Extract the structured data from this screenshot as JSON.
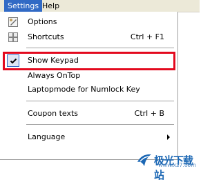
{
  "menubar": {
    "items": [
      {
        "label": "Settings",
        "active": true
      },
      {
        "label": "Help",
        "active": false
      }
    ]
  },
  "menu": {
    "options": {
      "label": "Options",
      "icon": "options-icon"
    },
    "shortcuts": {
      "label": "Shortcuts",
      "shortcut": "Ctrl + F1",
      "icon": "shortcuts-icon"
    },
    "show_keypad": {
      "label": "Show Keypad",
      "checked": true
    },
    "always_ontop": {
      "label": "Always OnTop"
    },
    "laptopmode": {
      "label": "Laptopmode for Numlock Key"
    },
    "coupon_texts": {
      "label": "Coupon texts",
      "shortcut": "Ctrl + B"
    },
    "language": {
      "label": "Language"
    }
  },
  "highlight_color": "#e3091e",
  "watermark": {
    "text": "极光下载站",
    "url": "www.xz7.com"
  }
}
